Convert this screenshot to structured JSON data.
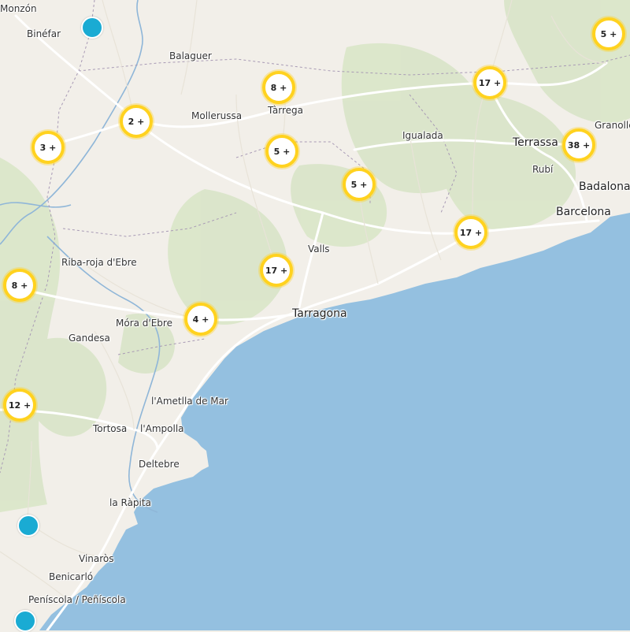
{
  "map": {
    "colors": {
      "land": "#f2efe9",
      "sea": "#94c0e0",
      "park": "#d6e3c4",
      "road": "#ffffff",
      "cluster_border": "#ffd21f",
      "point": "#1aabd3"
    },
    "places": {
      "monzon": "Monzón",
      "binefar": "Binéfar",
      "balaguer": "Balaguer",
      "mollerussa": "Mollerussa",
      "tarrega": "Tàrrega",
      "igualada": "Igualada",
      "terrassa": "Terrassa",
      "rubi": "Rubí",
      "granollers": "Granolle",
      "badalona": "Badalona",
      "barcelona": "Barcelona",
      "valls": "Valls",
      "riba_roja": "Riba-roja d'Ebre",
      "mora": "Móra d'Ebre",
      "gandesa": "Gandesa",
      "tarragona": "Tarragona",
      "ametlla": "l'Ametlla de Mar",
      "tortosa": "Tortosa",
      "ampolla": "l'Ampolla",
      "deltebre": "Deltebre",
      "rapita": "la Ràpita",
      "vinaros": "Vinaròs",
      "benicarlo": "Benicarló",
      "peniscola": "Peníscola / Peñíscola"
    },
    "clusters": {
      "c1": "5 +",
      "c2": "17 +",
      "c3": "8 +",
      "c4": "2 +",
      "c5": "3 +",
      "c6": "5 +",
      "c7": "38 +",
      "c8": "5 +",
      "c9": "17 +",
      "c10": "17 +",
      "c11": "8 +",
      "c12": "4 +",
      "c13": "12 +"
    }
  }
}
